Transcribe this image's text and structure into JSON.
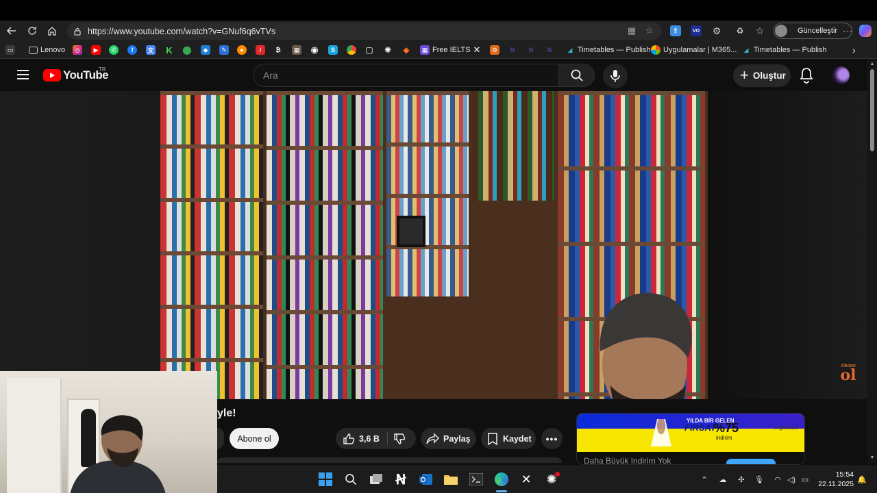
{
  "browser": {
    "url": "https://www.youtube.com/watch?v=GNuf6q6vTVs",
    "update_label": "Güncelleştir",
    "bookmarks": [
      {
        "label": "Lenovo"
      },
      {
        "label": "Free IELTS"
      },
      {
        "label": "Timetables — Publish"
      },
      {
        "label": "Uygulamalar | M365..."
      },
      {
        "label": "Timetables — Publish"
      }
    ]
  },
  "youtube": {
    "logo_text": "YouTube",
    "country_code": "TR",
    "search_placeholder": "Ara",
    "create_label": "Oluştur"
  },
  "video": {
    "title_fragment": "yle!",
    "subscribe_label": "Abone ol",
    "like_count": "3,6 B",
    "share_label": "Paylaş",
    "save_label": "Kaydet",
    "watermark_small": "Abone",
    "watermark_large": "ol"
  },
  "ad": {
    "line1": "YILDA BİR GELEN",
    "line2": "FIRSAT",
    "percent": "%75",
    "discount": "indirim",
    "brand": "englishcast",
    "row_text": "Daha Büyük Indirim Yok"
  },
  "taskbar": {
    "time": "15:54",
    "date": "22.11.2025"
  },
  "colors": {
    "yt_red": "#ff0000",
    "bg_dark": "#0f0f0f",
    "ad_yellow": "#f7e600"
  }
}
